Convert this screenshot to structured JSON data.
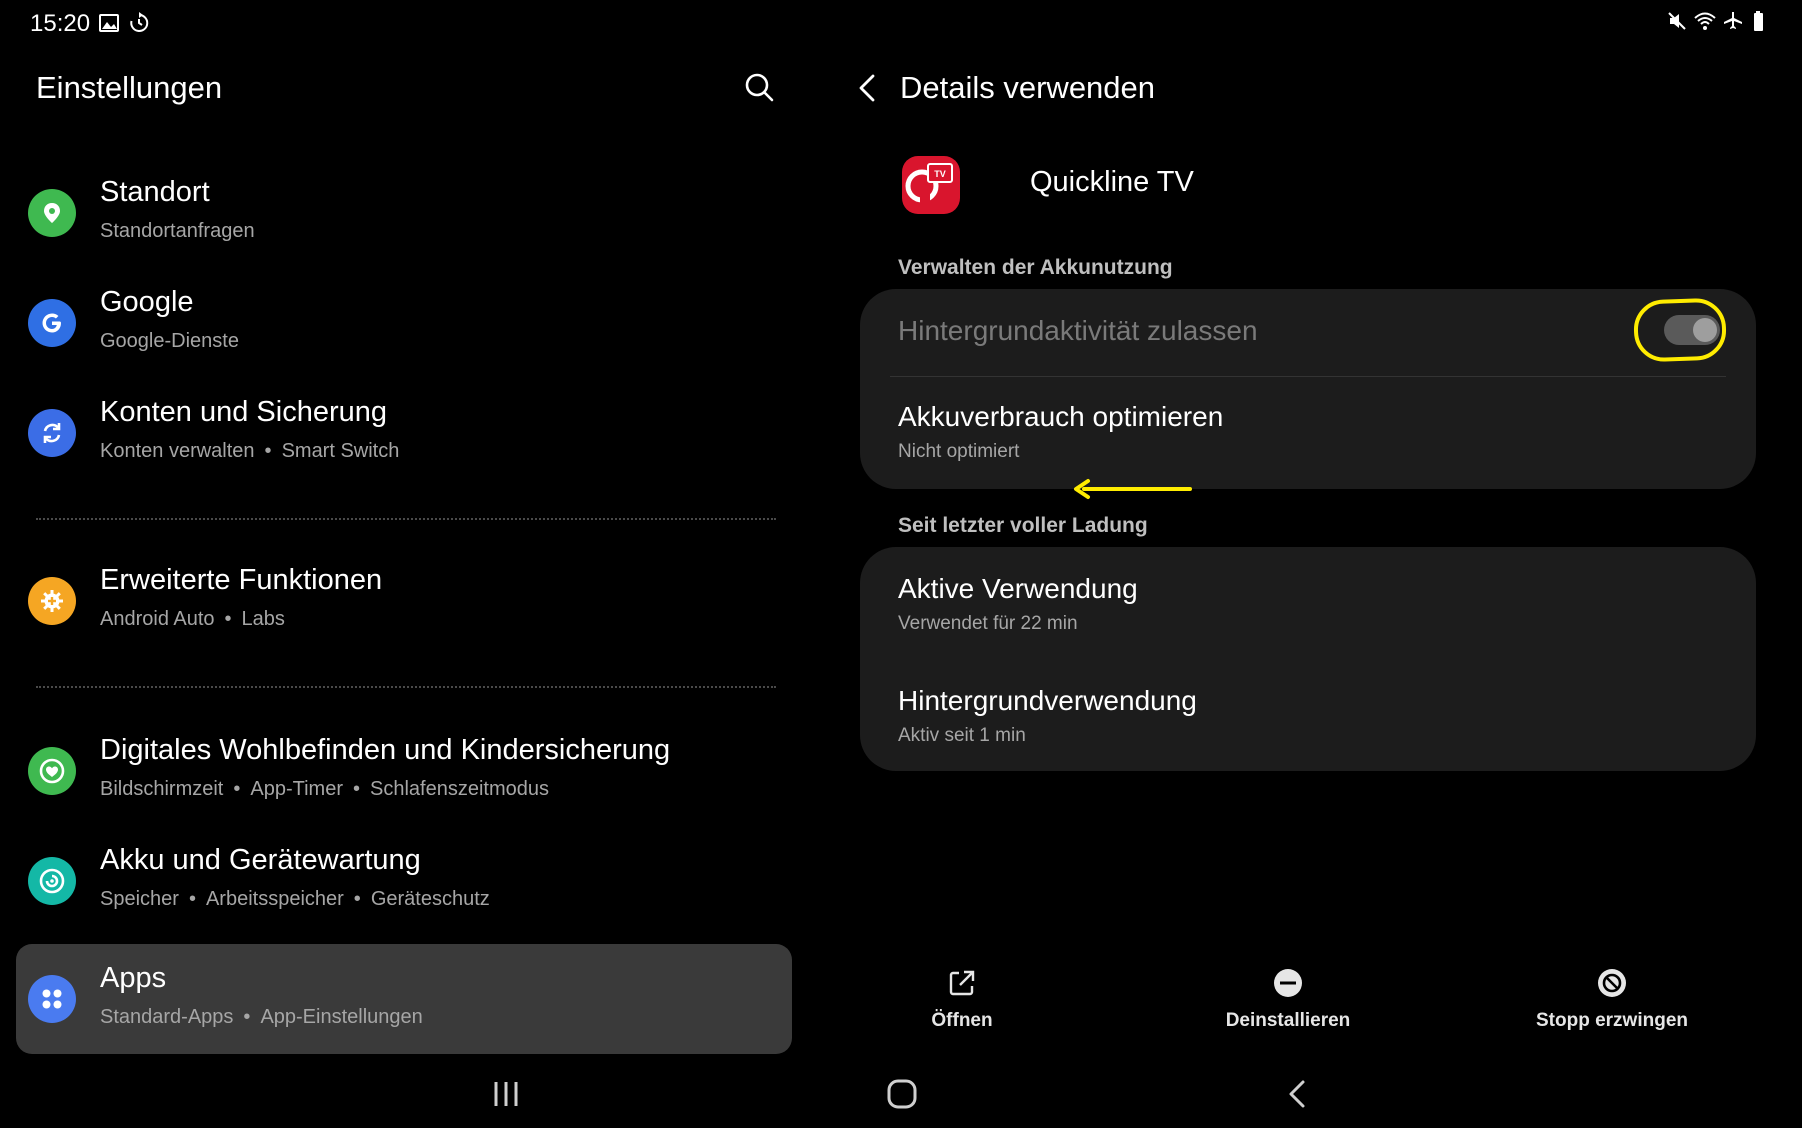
{
  "status_bar": {
    "time": "15:20",
    "left_icons": [
      "image-icon",
      "sync-icon"
    ],
    "right_icons": [
      "mute-icon",
      "wifi-icon",
      "airplane-icon",
      "battery-icon"
    ]
  },
  "left_panel": {
    "title": "Einstellungen",
    "items": [
      {
        "title": "Standort",
        "subtitle": [
          "Standortanfragen"
        ],
        "icon": "location-icon",
        "color": "#3fb950"
      },
      {
        "title": "Google",
        "subtitle": [
          "Google-Dienste"
        ],
        "icon": "google-icon",
        "color": "#2f6fe4"
      },
      {
        "title": "Konten und Sicherung",
        "subtitle": [
          "Konten verwalten",
          "Smart Switch"
        ],
        "icon": "sync-icon",
        "color": "#3b6de6"
      },
      {
        "title": "Erweiterte Funktionen",
        "subtitle": [
          "Android Auto",
          "Labs"
        ],
        "icon": "gear-plus-icon",
        "color": "#f5a623"
      },
      {
        "title": "Digitales Wohlbefinden und Kindersicherung",
        "subtitle": [
          "Bildschirmzeit",
          "App-Timer",
          "Schlafenszeitmodus"
        ],
        "icon": "heart-circle-icon",
        "color": "#3fb950"
      },
      {
        "title": "Akku und Gerätewartung",
        "subtitle": [
          "Speicher",
          "Arbeitsspeicher",
          "Geräteschutz"
        ],
        "icon": "device-care-icon",
        "color": "#14b8a6"
      },
      {
        "title": "Apps",
        "subtitle": [
          "Standard-Apps",
          "App-Einstellungen"
        ],
        "icon": "apps-grid-icon",
        "color": "#4a7bf0",
        "selected": true
      }
    ]
  },
  "right_panel": {
    "title": "Details verwenden",
    "app_name": "Quickline TV",
    "app_icon_text": "TV",
    "section_battery": "Verwalten der Akkunutzung",
    "background_activity": {
      "title": "Hintergrundaktivität zulassen",
      "enabled": false,
      "state": "on"
    },
    "optimize": {
      "title": "Akkuverbrauch optimieren",
      "subtitle": "Nicht optimiert"
    },
    "section_since_charge": "Seit letzter voller Ladung",
    "active_usage": {
      "title": "Aktive Verwendung",
      "subtitle": "Verwendet für 22 min"
    },
    "background_usage": {
      "title": "Hintergrundverwendung",
      "subtitle": "Aktiv seit 1 min"
    },
    "actions": {
      "open": "Öffnen",
      "uninstall": "Deinstallieren",
      "force_stop": "Stopp erzwingen"
    }
  },
  "annotation_color": "#ffec00",
  "nav_bar": [
    "recents-icon",
    "home-icon",
    "back-icon"
  ]
}
